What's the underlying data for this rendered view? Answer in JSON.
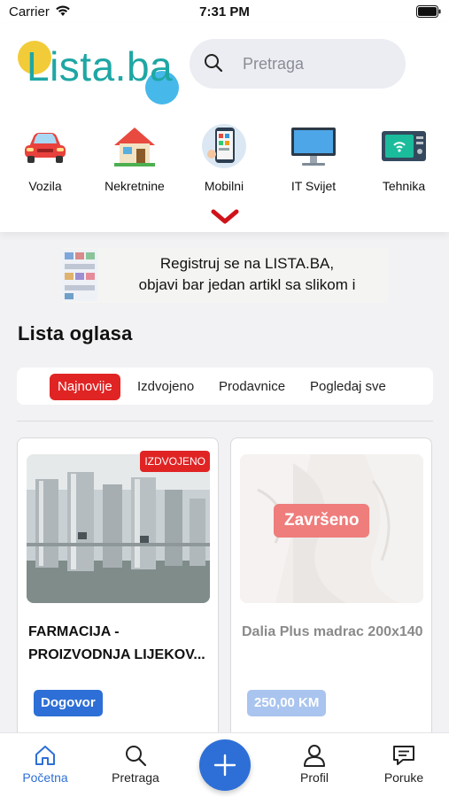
{
  "status_bar": {
    "carrier": "Carrier",
    "time": "7:31 PM"
  },
  "header": {
    "logo_text": "Lista.ba",
    "search_placeholder": "Pretraga"
  },
  "categories": [
    {
      "label": "Vozila",
      "icon": "car-icon"
    },
    {
      "label": "Nekretnine",
      "icon": "house-icon"
    },
    {
      "label": "Mobilni",
      "icon": "mobile-phone-icon"
    },
    {
      "label": "IT Svijet",
      "icon": "computer-monitor-icon"
    },
    {
      "label": "Tehnika",
      "icon": "appliance-icon"
    }
  ],
  "banner": {
    "line1": "Registruj se na LISTA.BA,",
    "line2": "objavi bar jedan artikl sa slikom i"
  },
  "section_title": "Lista oglasa",
  "filters": [
    {
      "label": "Najnovije",
      "active": true
    },
    {
      "label": "Izdvojeno",
      "active": false
    },
    {
      "label": "Prodavnice",
      "active": false
    },
    {
      "label": "Pogledaj sve",
      "active": false
    }
  ],
  "listings": [
    {
      "title": "FARMACIJA - PROIZVODNJA LIJEKOV...",
      "price": "Dogovor",
      "badge": "IZDVOJENO",
      "price_color": "#2d6fd6"
    },
    {
      "title": "Dalia Plus madrac 200x140",
      "price": "250,00 KM",
      "badge": "Završeno",
      "price_color": "#a9c4ee"
    }
  ],
  "tab_bar": [
    {
      "label": "Početna",
      "icon": "home-icon",
      "active": true
    },
    {
      "label": "Pretraga",
      "icon": "search-icon",
      "active": false
    },
    {
      "label": "Profil",
      "icon": "user-icon",
      "active": false
    },
    {
      "label": "Poruke",
      "icon": "message-icon",
      "active": false
    }
  ],
  "colors": {
    "accent": "#2d6fd6",
    "active_filter": "#e02424",
    "logo": "#1ea7a4"
  }
}
